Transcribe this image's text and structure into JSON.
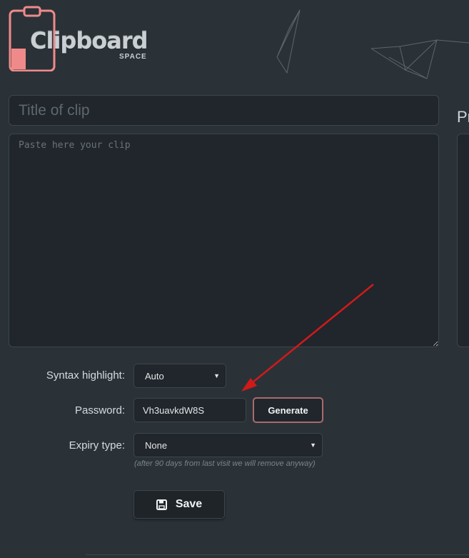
{
  "brand": {
    "name": "Clipboard",
    "sub": "SPACE",
    "accent_color": "#f08a8a"
  },
  "form": {
    "title_placeholder": "Title of clip",
    "clip_placeholder": "Paste here your clip",
    "syntax": {
      "label": "Syntax highlight:",
      "selected": "Auto"
    },
    "password": {
      "label": "Password:",
      "value": "Vh3uavkdW8S",
      "generate_label": "Generate"
    },
    "expiry": {
      "label": "Expiry type:",
      "selected": "None",
      "hint": "(after 90 days from last visit we will remove anyway)"
    },
    "save_label": "Save"
  },
  "side": {
    "heading": "Pr"
  },
  "annotation": {
    "arrow_color": "#d01a1a"
  }
}
